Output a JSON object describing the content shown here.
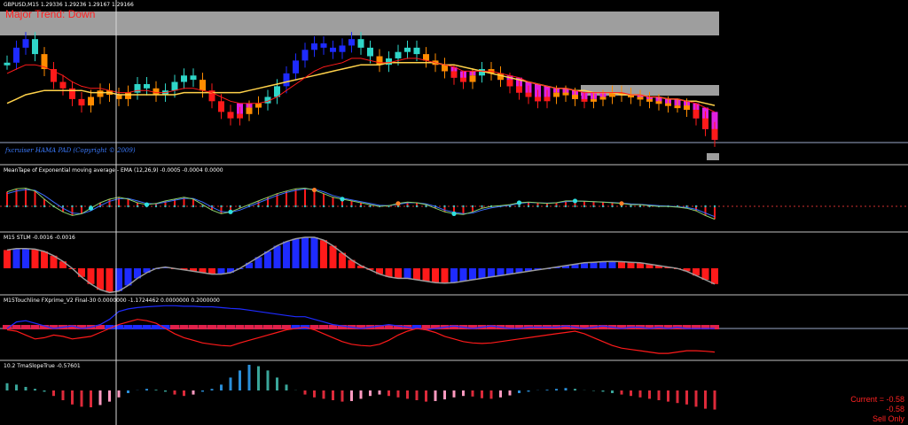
{
  "window": {
    "title": "GBPUSD,M15  1.29336 1.29236 1.29167 1.29166"
  },
  "annotations": {
    "trend": "Major Trend: Down",
    "copyright": "fxcruiser HAMA PAD (Copyright © 2009)"
  },
  "panel_titles": {
    "macd": "MeanTape of Exponential moving average - EMA (12,26,9) -0.0005 -0.0004 0.0000",
    "stlm": "M15 STLM -0.0016 -0.0016",
    "touchline": "M15Touchline  FXprime_V2 Final-30 0.0000000 -1.1724462 0.0000000 0.2000000",
    "slope": "10.2 TmaSlopeTrue -0.57601"
  },
  "status": {
    "current": "Current = -0.58",
    "value": "-0.58",
    "signal": "Sell Only"
  },
  "colors": {
    "background": "#000000",
    "bull_strong": "#1e2bff",
    "bull": "#2fd6c8",
    "bear": "#ff1a1a",
    "bear_weak": "#ff8c00",
    "hama_band": "#e020e0",
    "slow_ma": "#ffd24a",
    "zone": "#9e9e9e",
    "slope_up_strong": "#2a8ed8",
    "slope_up": "#3aa69a",
    "slope_down_strong": "#dd2a3a",
    "slope_down": "#ff9ac0"
  },
  "chart_data": [
    {
      "type": "candlestick",
      "panel": "price",
      "title": "GBPUSD,M15",
      "close": [
        1.2951,
        1.2958,
        1.2962,
        1.2955,
        1.2948,
        1.2942,
        1.2939,
        1.2934,
        1.2931,
        1.2935,
        1.2938,
        1.2936,
        1.2934,
        1.2937,
        1.2941,
        1.2939,
        1.2936,
        1.2938,
        1.2942,
        1.2945,
        1.2943,
        1.2938,
        1.2933,
        1.2928,
        1.2925,
        1.2927,
        1.293,
        1.2932,
        1.2935,
        1.294,
        1.2946,
        1.2952,
        1.2957,
        1.296,
        1.2958,
        1.2956,
        1.2959,
        1.2962,
        1.2958,
        1.2954,
        1.295,
        1.2953,
        1.2956,
        1.2958,
        1.2955,
        1.2952,
        1.295,
        1.2947,
        1.2944,
        1.2942,
        1.2945,
        1.2948,
        1.2946,
        1.2943,
        1.294,
        1.2937,
        1.2935,
        1.2933,
        1.2935,
        1.2937,
        1.2936,
        1.2934,
        1.2933,
        1.2934,
        1.2935,
        1.2937,
        1.2936,
        1.2935,
        1.2934,
        1.2933,
        1.2932,
        1.2931,
        1.2931,
        1.2929,
        1.2925,
        1.292,
        1.2915
      ],
      "hama_line": [
        1.2946,
        1.2948,
        1.295,
        1.295,
        1.2949,
        1.2947,
        1.2945,
        1.2942,
        1.294,
        1.2939,
        1.2939,
        1.2938,
        1.2937,
        1.2937,
        1.2938,
        1.2938,
        1.2937,
        1.2937,
        1.2938,
        1.2939,
        1.2939,
        1.2938,
        1.2937,
        1.2935,
        1.2933,
        1.2932,
        1.2932,
        1.2932,
        1.2933,
        1.2935,
        1.2938,
        1.2941,
        1.2944,
        1.2947,
        1.2949,
        1.295,
        1.2951,
        1.2953,
        1.2953,
        1.2952,
        1.2951,
        1.2951,
        1.2952,
        1.2953,
        1.2953,
        1.2952,
        1.2951,
        1.295,
        1.2949,
        1.2947,
        1.2947,
        1.2947,
        1.2947,
        1.2946,
        1.2945,
        1.2944,
        1.2942,
        1.2941,
        1.294,
        1.2939,
        1.2939,
        1.2938,
        1.2937,
        1.2937,
        1.2937,
        1.2937,
        1.2937,
        1.2936,
        1.2936,
        1.2935,
        1.2935,
        1.2934,
        1.2934,
        1.2933,
        1.2932,
        1.293,
        1.2928
      ],
      "slow_ma": [
        1.2932,
        1.2934,
        1.2936,
        1.2937,
        1.2938,
        1.2938,
        1.2938,
        1.2938,
        1.2938,
        1.2937,
        1.2937,
        1.2937,
        1.2936,
        1.2936,
        1.2936,
        1.2936,
        1.2936,
        1.2936,
        1.2936,
        1.2937,
        1.2937,
        1.2937,
        1.2937,
        1.2937,
        1.2937,
        1.2937,
        1.2938,
        1.2939,
        1.294,
        1.2941,
        1.2942,
        1.2943,
        1.2944,
        1.2945,
        1.2946,
        1.2947,
        1.2948,
        1.2949,
        1.295,
        1.295,
        1.295,
        1.2951,
        1.2951,
        1.2951,
        1.2951,
        1.2951,
        1.2951,
        1.295,
        1.295,
        1.2949,
        1.2948,
        1.2947,
        1.2946,
        1.2945,
        1.2944,
        1.2943,
        1.2942,
        1.2941,
        1.294,
        1.2939,
        1.2939,
        1.2938,
        1.2938,
        1.2937,
        1.2937,
        1.2937,
        1.2936,
        1.2936,
        1.2936,
        1.2935,
        1.2935,
        1.2934,
        1.2934,
        1.2933,
        1.2933,
        1.2932,
        1.2931
      ],
      "ylim": [
        1.2905,
        1.2972
      ]
    },
    {
      "type": "line",
      "panel": "macd",
      "series": [
        {
          "values": [
            0.3,
            0.38,
            0.4,
            0.32,
            0.1,
            -0.1,
            -0.25,
            -0.35,
            -0.3,
            -0.15,
            0.0,
            0.1,
            0.15,
            0.1,
            0.0,
            -0.05,
            -0.02,
            0.05,
            0.1,
            0.15,
            0.1,
            -0.05,
            -0.2,
            -0.3,
            -0.25,
            -0.15,
            -0.05,
            0.05,
            0.15,
            0.25,
            0.32,
            0.38,
            0.4,
            0.35,
            0.25,
            0.15,
            0.1,
            0.05,
            0.0,
            -0.05,
            -0.1,
            -0.08,
            -0.02,
            0.02,
            0.0,
            -0.05,
            -0.15,
            -0.25,
            -0.3,
            -0.32,
            -0.25,
            -0.15,
            -0.1,
            -0.08,
            -0.05,
            0.0,
            0.02,
            0.0,
            -0.02,
            0.0,
            0.05,
            0.05,
            0.04,
            0.03,
            0.02,
            0.0,
            -0.02,
            -0.05,
            -0.05,
            -0.08,
            -0.1,
            -0.1,
            -0.12,
            -0.15,
            -0.22,
            -0.35,
            -0.45
          ]
        },
        {
          "values": [
            0.25,
            0.32,
            0.36,
            0.34,
            0.2,
            0.02,
            -0.15,
            -0.28,
            -0.3,
            -0.22,
            -0.08,
            0.04,
            0.11,
            0.12,
            0.05,
            -0.02,
            -0.03,
            0.02,
            0.07,
            0.12,
            0.12,
            0.02,
            -0.12,
            -0.24,
            -0.26,
            -0.2,
            -0.1,
            0.0,
            0.1,
            0.2,
            0.28,
            0.34,
            0.38,
            0.37,
            0.3,
            0.2,
            0.13,
            0.08,
            0.03,
            -0.02,
            -0.07,
            -0.08,
            -0.04,
            0.0,
            0.0,
            -0.03,
            -0.1,
            -0.2,
            -0.26,
            -0.3,
            -0.28,
            -0.2,
            -0.14,
            -0.1,
            -0.07,
            -0.02,
            0.01,
            0.0,
            -0.01,
            0.0,
            0.03,
            0.04,
            0.04,
            0.03,
            0.02,
            0.01,
            -0.01,
            -0.03,
            -0.04,
            -0.06,
            -0.08,
            -0.09,
            -0.11,
            -0.13,
            -0.18,
            -0.28,
            -0.38
          ]
        }
      ],
      "ylim": [
        -0.8,
        0.8
      ]
    },
    {
      "type": "bar",
      "panel": "stlm",
      "values": [
        0.55,
        0.6,
        0.6,
        0.58,
        0.5,
        0.35,
        0.15,
        -0.1,
        -0.4,
        -0.65,
        -0.85,
        -0.95,
        -0.9,
        -0.7,
        -0.45,
        -0.25,
        -0.1,
        -0.05,
        -0.1,
        -0.15,
        -0.2,
        -0.25,
        -0.3,
        -0.3,
        -0.25,
        -0.1,
        0.1,
        0.3,
        0.5,
        0.7,
        0.85,
        0.95,
        1.0,
        1.0,
        0.9,
        0.7,
        0.45,
        0.2,
        0.0,
        -0.15,
        -0.3,
        -0.4,
        -0.45,
        -0.45,
        -0.5,
        -0.55,
        -0.6,
        -0.62,
        -0.6,
        -0.55,
        -0.5,
        -0.45,
        -0.4,
        -0.35,
        -0.3,
        -0.25,
        -0.2,
        -0.15,
        -0.1,
        -0.05,
        0.0,
        0.05,
        0.1,
        0.12,
        0.14,
        0.15,
        0.14,
        0.12,
        0.1,
        0.05,
        0.0,
        -0.05,
        -0.1,
        -0.2,
        -0.35,
        -0.5,
        -0.65
      ],
      "ylim": [
        -1.0,
        1.0
      ]
    },
    {
      "type": "line",
      "panel": "touchline",
      "series": [
        {
          "values": [
            -0.05,
            0.2,
            0.25,
            0.15,
            0.05,
            -0.05,
            0.0,
            0.05,
            -0.05,
            0.0,
            0.1,
            0.3,
            0.6,
            0.7,
            0.75,
            0.78,
            0.8,
            0.82,
            0.82,
            0.8,
            0.8,
            0.78,
            0.78,
            0.75,
            0.72,
            0.7,
            0.65,
            0.6,
            0.55,
            0.5,
            0.45,
            0.4,
            0.4,
            0.3,
            0.2,
            0.1,
            0.05,
            0.0,
            -0.05,
            0.0,
            0.05,
            0.1,
            0.05,
            0.0,
            -0.05,
            -0.1,
            -0.05,
            0.0,
            0.05,
            0.0,
            -0.05,
            0.0,
            0.05,
            0.0,
            -0.05,
            -0.05,
            0.0,
            0.0,
            0.0,
            0.0,
            0.05,
            0.0,
            -0.05,
            0.0,
            0.05,
            0.0,
            -0.05,
            0.0,
            0.0,
            -0.05,
            0.0,
            -0.05,
            0.0,
            -0.05,
            -0.05,
            -0.05,
            -0.05
          ]
        },
        {
          "values": [
            -0.1,
            -0.15,
            -0.3,
            -0.45,
            -0.4,
            -0.3,
            -0.35,
            -0.45,
            -0.4,
            -0.35,
            -0.2,
            -0.05,
            0.1,
            0.2,
            0.3,
            0.25,
            0.15,
            -0.05,
            -0.25,
            -0.4,
            -0.5,
            -0.6,
            -0.65,
            -0.7,
            -0.72,
            -0.6,
            -0.5,
            -0.4,
            -0.3,
            -0.2,
            -0.1,
            -0.05,
            0.0,
            -0.1,
            -0.25,
            -0.4,
            -0.55,
            -0.65,
            -0.7,
            -0.72,
            -0.65,
            -0.5,
            -0.3,
            -0.15,
            -0.05,
            -0.1,
            -0.2,
            -0.35,
            -0.45,
            -0.55,
            -0.6,
            -0.62,
            -0.6,
            -0.55,
            -0.5,
            -0.45,
            -0.4,
            -0.35,
            -0.3,
            -0.25,
            -0.2,
            -0.15,
            -0.25,
            -0.4,
            -0.55,
            -0.7,
            -0.8,
            -0.85,
            -0.9,
            -0.95,
            -1.0,
            -1.0,
            -0.95,
            -0.9,
            -0.9,
            -0.92,
            -0.95
          ]
        }
      ],
      "ylim": [
        -1.2,
        1.0
      ]
    },
    {
      "type": "bar",
      "panel": "slope",
      "values": [
        0.35,
        0.3,
        0.22,
        0.15,
        0.05,
        -0.1,
        -0.25,
        -0.4,
        -0.48,
        -0.5,
        -0.42,
        -0.3,
        -0.15,
        0.0,
        0.1,
        0.15,
        0.12,
        0.05,
        -0.05,
        -0.1,
        -0.05,
        0.05,
        0.15,
        0.3,
        0.55,
        0.8,
        1.0,
        0.95,
        0.8,
        0.55,
        0.3,
        0.1,
        -0.05,
        -0.15,
        -0.2,
        -0.25,
        -0.3,
        -0.28,
        -0.2,
        -0.1,
        -0.05,
        -0.1,
        -0.15,
        -0.2,
        -0.25,
        -0.3,
        -0.28,
        -0.22,
        -0.15,
        -0.1,
        -0.12,
        -0.18,
        -0.2,
        -0.15,
        -0.08,
        0.0,
        0.05,
        0.1,
        0.12,
        0.15,
        0.18,
        0.15,
        0.1,
        0.08,
        0.05,
        0.0,
        -0.05,
        -0.1,
        -0.15,
        -0.2,
        -0.25,
        -0.3,
        -0.35,
        -0.4,
        -0.48,
        -0.55,
        -0.58
      ],
      "ylim": [
        -1.0,
        1.0
      ]
    }
  ]
}
